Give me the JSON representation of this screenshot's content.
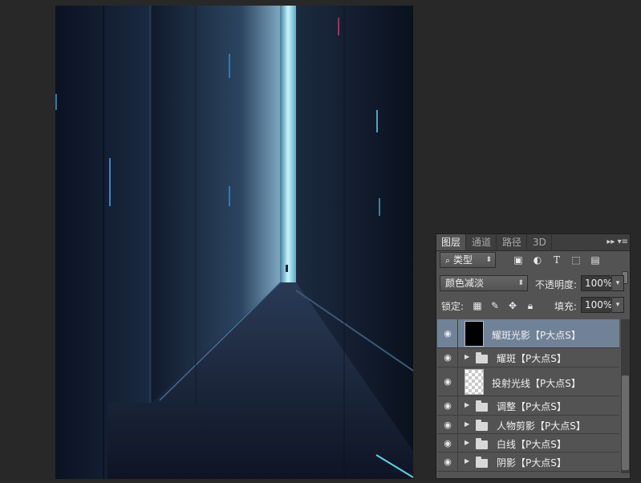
{
  "panel": {
    "tabs": [
      "图层",
      "通道",
      "路径",
      "3D"
    ],
    "active_tab": "图层",
    "menu_icons": [
      "expand-icon",
      "panel-menu-icon"
    ],
    "filter": {
      "kind_label": "类型",
      "icons": [
        "image-filter-icon",
        "adjustment-filter-icon",
        "text-filter-icon",
        "shape-filter-icon",
        "smart-object-filter-icon"
      ]
    },
    "blend_mode": "颜色减淡",
    "opacity_label": "不透明度:",
    "opacity_value": "100%",
    "lock_label": "锁定:",
    "lock_icons": [
      "lock-transparent-icon",
      "lock-pixels-icon",
      "lock-position-icon",
      "lock-all-icon"
    ],
    "fill_label": "填充:",
    "fill_value": "100%",
    "layers": [
      {
        "name": "耀斑光影【P大点S】",
        "type": "layer",
        "thumb": "dark",
        "selected": true
      },
      {
        "name": "耀斑【P大点S】",
        "type": "group",
        "selected": false
      },
      {
        "name": "投射光线【P大点S】",
        "type": "layer",
        "thumb": "transparent",
        "selected": false
      },
      {
        "name": "调整【P大点S】",
        "type": "group",
        "selected": false
      },
      {
        "name": "人物剪影【P大点S】",
        "type": "group",
        "selected": false
      },
      {
        "name": "白线【P大点S】",
        "type": "group",
        "selected": false
      },
      {
        "name": "阴影【P大点S】",
        "type": "group",
        "selected": false
      }
    ]
  },
  "colors": {
    "workspace": "#282828",
    "panel": "#535353",
    "selected_layer": "#6f8297",
    "canvas_dark": "#0a0f1c",
    "light_beam": "#9fe6f2"
  }
}
